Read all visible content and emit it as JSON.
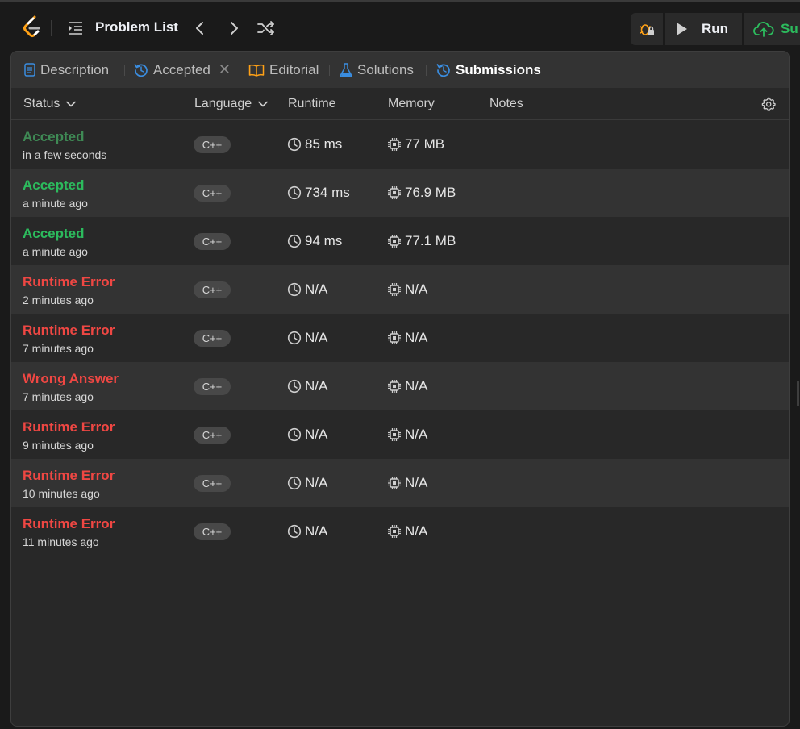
{
  "topbar": {
    "problem_list_label": "Problem List",
    "run_label": "Run",
    "submit_label": "Su"
  },
  "tabs": [
    {
      "label": "Description",
      "icon": "document-icon"
    },
    {
      "label": "Accepted",
      "icon": "history-icon"
    },
    {
      "label": "Editorial",
      "icon": "book-icon"
    },
    {
      "label": "Solutions",
      "icon": "flask-icon"
    },
    {
      "label": "Submissions",
      "icon": "history-icon",
      "active": true
    }
  ],
  "table": {
    "headers": {
      "status": "Status",
      "language": "Language",
      "runtime": "Runtime",
      "memory": "Memory",
      "notes": "Notes"
    },
    "rows": [
      {
        "status": "Accepted",
        "time": "in a few seconds",
        "lang": "C++",
        "runtime": "85 ms",
        "memory": "77 MB"
      },
      {
        "status": "Accepted",
        "time": "a minute ago",
        "lang": "C++",
        "runtime": "734 ms",
        "memory": "76.9 MB"
      },
      {
        "status": "Accepted",
        "time": "a minute ago",
        "lang": "C++",
        "runtime": "94 ms",
        "memory": "77.1 MB"
      },
      {
        "status": "Runtime Error",
        "time": "2 minutes ago",
        "lang": "C++",
        "runtime": "N/A",
        "memory": "N/A"
      },
      {
        "status": "Runtime Error",
        "time": "7 minutes ago",
        "lang": "C++",
        "runtime": "N/A",
        "memory": "N/A"
      },
      {
        "status": "Wrong Answer",
        "time": "7 minutes ago",
        "lang": "C++",
        "runtime": "N/A",
        "memory": "N/A"
      },
      {
        "status": "Runtime Error",
        "time": "9 minutes ago",
        "lang": "C++",
        "runtime": "N/A",
        "memory": "N/A"
      },
      {
        "status": "Runtime Error",
        "time": "10 minutes ago",
        "lang": "C++",
        "runtime": "N/A",
        "memory": "N/A"
      },
      {
        "status": "Runtime Error",
        "time": "11 minutes ago",
        "lang": "C++",
        "runtime": "N/A",
        "memory": "N/A"
      }
    ]
  },
  "colors": {
    "accepted": "#2cbb5d",
    "error": "#ef4743",
    "accent": "#3a8de0",
    "logo_orange": "#ffa116"
  }
}
